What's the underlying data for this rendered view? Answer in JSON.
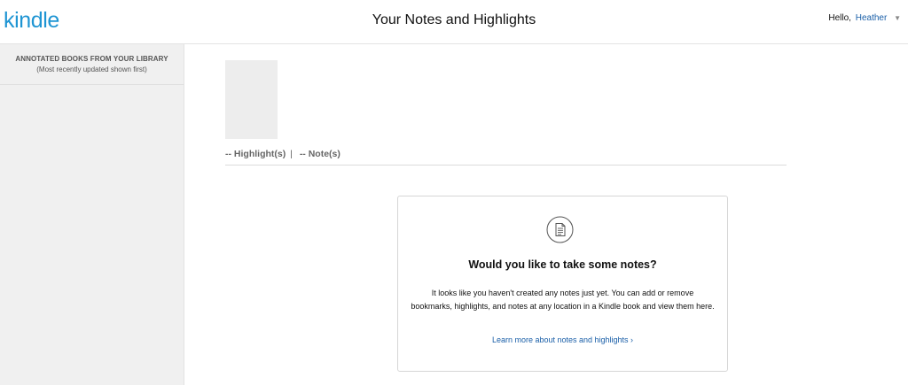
{
  "header": {
    "logo": "kindle",
    "title": "Your Notes and Highlights",
    "greeting": "Hello,",
    "user_name": "Heather",
    "caret": "▼"
  },
  "sidebar": {
    "title": "ANNOTATED BOOKS FROM YOUR LIBRARY",
    "subtitle": "(Most recently updated shown first)"
  },
  "book": {
    "highlights_label": "-- Highlight(s)",
    "separator": "|",
    "notes_label": "-- Note(s)"
  },
  "empty_state": {
    "icon": "document-icon",
    "heading": "Would you like to take some notes?",
    "body": "It looks like you haven't created any notes just yet. You can add or remove bookmarks, highlights, and notes at any location in a Kindle book and view them here.",
    "link": "Learn more about notes and highlights ›"
  },
  "colors": {
    "brand": "#1f95d3",
    "link": "#1a5fa8",
    "sidebar_bg": "#f0f0f0"
  }
}
